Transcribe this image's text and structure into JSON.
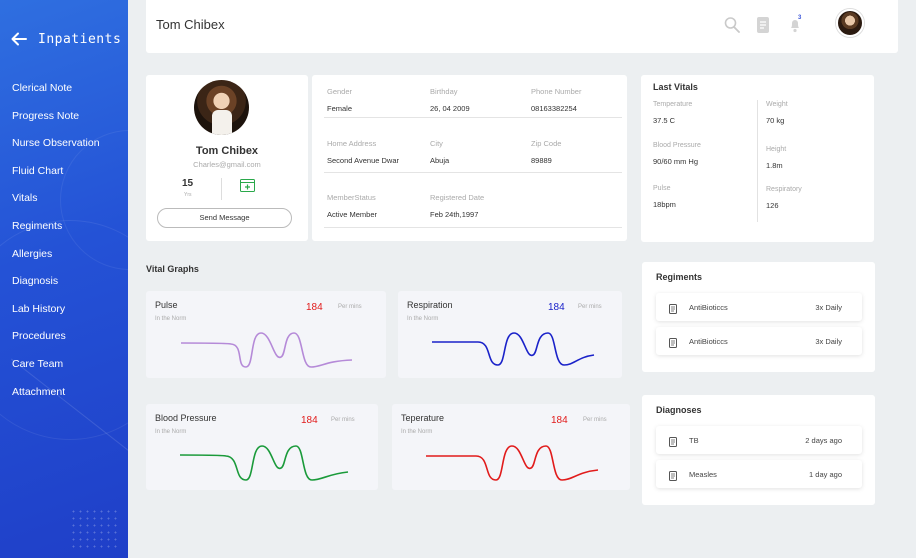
{
  "sidebar": {
    "title": "Inpatients",
    "items": [
      {
        "label": "Clerical Note"
      },
      {
        "label": "Progress Note"
      },
      {
        "label": "Nurse Observation"
      },
      {
        "label": "Fluid Chart"
      },
      {
        "label": "Vitals"
      },
      {
        "label": "Regiments"
      },
      {
        "label": "Allergies"
      },
      {
        "label": "Diagnosis"
      },
      {
        "label": "Lab History"
      },
      {
        "label": "Procedures"
      },
      {
        "label": "Care Team"
      },
      {
        "label": "Attachment"
      }
    ]
  },
  "header": {
    "title": "Tom Chibex",
    "notification_count": "3",
    "icons": [
      "search-icon",
      "document-icon",
      "bell-icon"
    ]
  },
  "profile": {
    "name": "Tom Chibex",
    "email": "Charles@gmail.com",
    "count": "15",
    "count_label": "Yrs",
    "send_label": "Send Message"
  },
  "info": {
    "gender_label": "Gender",
    "gender": "Female",
    "birthday_label": "Birthday",
    "birthday": "26, 04 2009",
    "phone_label": "Phone Number",
    "phone": "08163382254",
    "address_label": "Home Address",
    "address": "Second Avenue Dwar",
    "city_label": "City",
    "city": "Abuja",
    "zip_label": "Zip Code",
    "zip": "89889",
    "status_label": "MemberStatus",
    "status": "Active Member",
    "registered_label": "Registered Date",
    "registered": "Feb 24th,1997"
  },
  "last_vitals": {
    "title": "Last Vitals",
    "temperature_label": "Temperature",
    "temperature": "37.5 C",
    "bp_label": "Blood Pressure",
    "bp": "90/60 mm Hg",
    "pulse_label": "Pulse",
    "pulse": "18bpm",
    "weight_label": "Weight",
    "weight": "70 kg",
    "height_label": "Height",
    "height": "1.8m",
    "respiratory_label": "Respiratory",
    "respiratory": "126"
  },
  "vital_graphs": {
    "title": "Vital Graphs",
    "graphs": [
      {
        "name": "Pulse",
        "sub": "In the Norm",
        "value": "184",
        "unit": "Per mins",
        "color": "#b58ad8"
      },
      {
        "name": "Respiration",
        "sub": "In the Norm",
        "value": "184",
        "unit": "Per mins",
        "color": "#1a22c9"
      },
      {
        "name": "Blood Pressure",
        "sub": "In the Norm",
        "value": "184",
        "unit": "Per mins",
        "color": "#1a9a3a"
      },
      {
        "name": "Teperature",
        "sub": "In the Norm",
        "value": "184",
        "unit": "Per mins",
        "color": "#e11b1b"
      }
    ]
  },
  "regiments": {
    "title": "Regiments",
    "rows": [
      {
        "name": "AntiBioticcs",
        "value": "3x Daily"
      },
      {
        "name": "AntiBioticcs",
        "value": "3x Daily"
      }
    ]
  },
  "diagnoses": {
    "title": "Diagnoses",
    "rows": [
      {
        "name": "TB",
        "value": "2 days ago"
      },
      {
        "name": "Measles",
        "value": "1 day ago"
      }
    ]
  },
  "colors": {
    "sidebar": "#2452d6",
    "value_red": "#e11b1b",
    "value_blue": "#1a22c9"
  }
}
